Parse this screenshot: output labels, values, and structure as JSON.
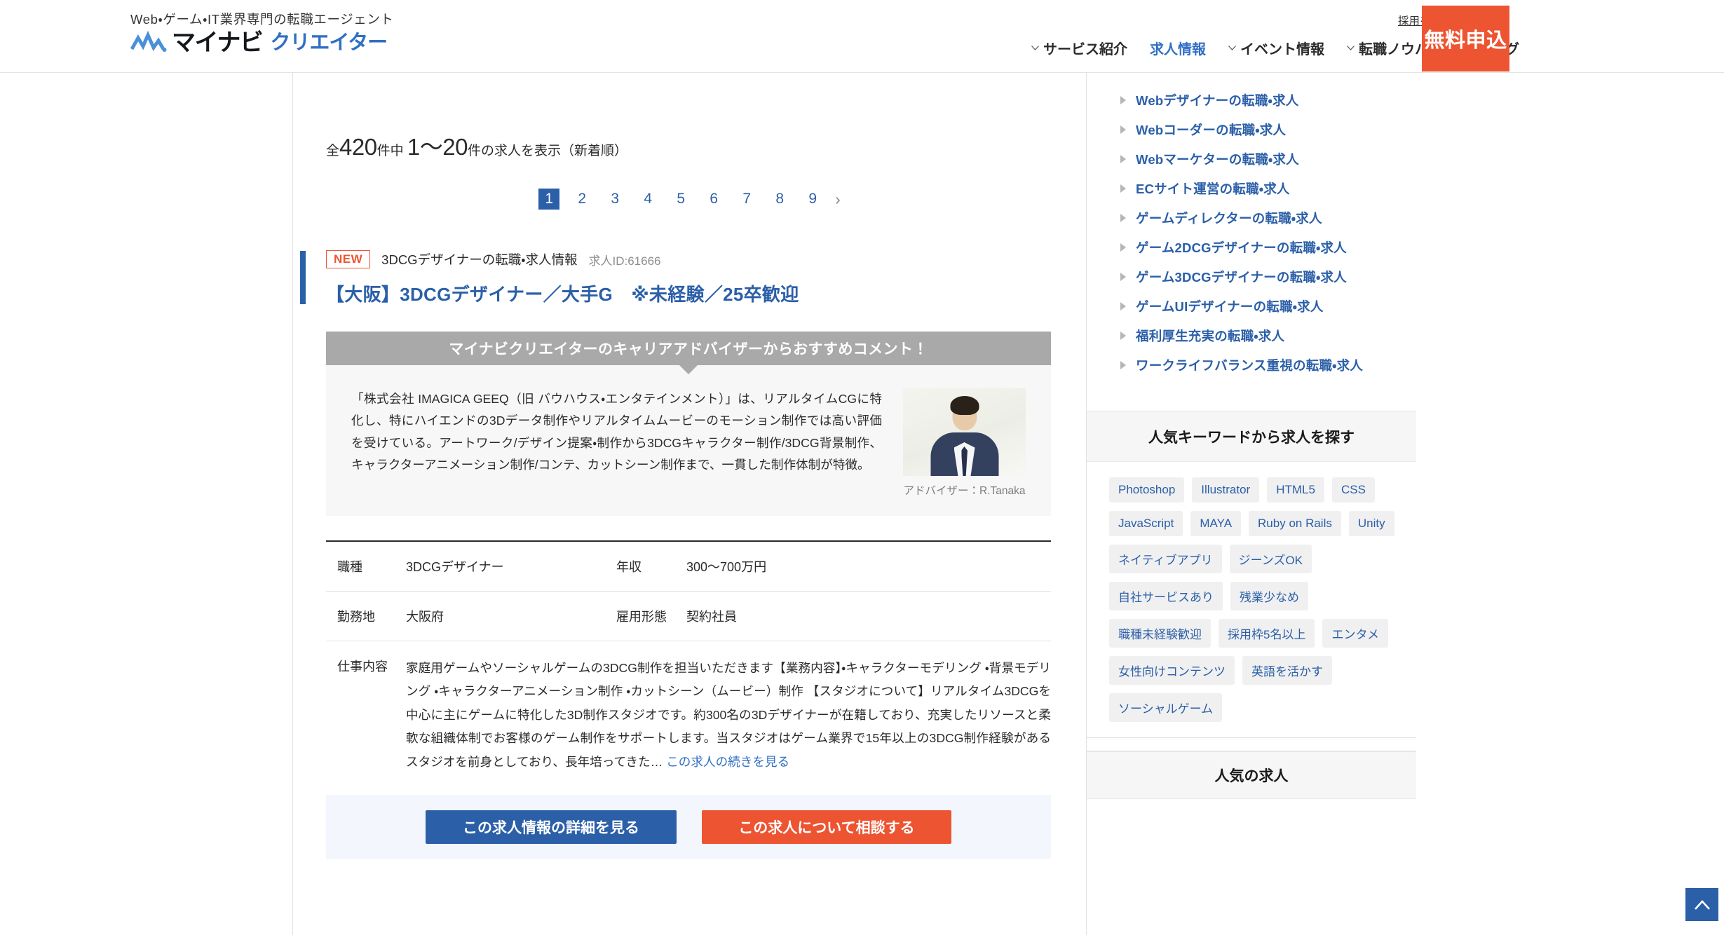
{
  "ghost": {
    "label": "この求人情報の詳細を見る"
  },
  "header": {
    "tagline": "Web・ゲーム・IT業界専門の転職エージェント",
    "logo": {
      "mark": "mynavi-wave-icon",
      "primary": "マイナビ",
      "secondary": "クリエイター"
    },
    "corporate_link": "採用を検討中の企業様",
    "nav": [
      {
        "label": "サービス紹介",
        "has_caret": true,
        "active": false
      },
      {
        "label": "求人情報",
        "has_caret": false,
        "active": true
      },
      {
        "label": "イベント情報",
        "has_caret": true,
        "active": false
      },
      {
        "label": "転職ノウハウ",
        "has_caret": true,
        "active": false
      },
      {
        "label": "ブログ",
        "has_caret": true,
        "active": false
      }
    ],
    "apply_button": "無料申込"
  },
  "results": {
    "prefix": "全",
    "total": "420",
    "mid": "件中",
    "range": "1〜20",
    "suffix": "件の求人を表示（新着順）"
  },
  "pagination": {
    "pages": [
      "1",
      "2",
      "3",
      "4",
      "5",
      "6",
      "7",
      "8",
      "9"
    ],
    "current": "1",
    "next_icon": "chevron-right-icon"
  },
  "job": {
    "badge": "NEW",
    "category": "3DCGデザイナーの転職・求人情報",
    "job_id": "求人ID:61666",
    "title": "【大阪】3DCGデザイナー／大手G　※未経験／25卒歓迎",
    "advisor": {
      "heading": "マイナビクリエイターのキャリアアドバイザーからおすすめコメント！",
      "comment": "「株式会社 IMAGICA GEEQ（旧 バウハウス・エンタテインメント）」は、リアルタイムCGに特化し、特にハイエンドの3Dデータ制作やリアルタイムムービーのモーション制作では高い評価を受けている。アートワーク/デザイン提案・制作から3DCGキャラクター制作/3DCG背景制作、キャラクターアニメーション制作/コンテ、カットシーン制作まで、一貫した制作体制が特徴。",
      "caption": "アドバイザー：R.Tanaka"
    },
    "spec": {
      "row1": {
        "label": "職種",
        "value": "3DCGデザイナー",
        "label2": "年収",
        "value2": "300〜700万円"
      },
      "row2": {
        "label": "勤務地",
        "value": "大阪府",
        "label2": "雇用形態",
        "value2": "契約社員"
      },
      "row3": {
        "label": "仕事内容",
        "value": "家庭用ゲームやソーシャルゲームの3DCG制作を担当いただきます【業務内容】・キャラクターモデリング ・背景モデリング ・キャラクターアニメーション制作 ・カットシーン（ムービー）制作 【スタジオについて】リアルタイム3DCGを中心に主にゲームに特化した3D制作スタジオです。約300名の3Dデザイナーが在籍しており、充実したリソースと柔軟な組織体制でお客様のゲーム制作をサポートします。当スタジオはゲーム業界で15年以上の3DCG制作経験があるスタジオを前身としており、長年培ってきた…",
        "more_link": "この求人の続きを見る"
      }
    },
    "cta_primary": "この求人情報の詳細を見る",
    "cta_secondary": "この求人について相談する"
  },
  "sidebar": {
    "links": [
      "Webデザイナーの転職・求人",
      "Webコーダーの転職・求人",
      "Webマーケターの転職・求人",
      "ECサイト運営の転職・求人",
      "ゲームディレクターの転職・求人",
      "ゲーム2DCGデザイナーの転職・求人",
      "ゲーム3DCGデザイナーの転職・求人",
      "ゲームUIデザイナーの転職・求人",
      "福利厚生充実の転職・求人",
      "ワークライフバランス重視の転職・求人"
    ],
    "keyword_panel": {
      "title": "人気キーワードから求人を探す",
      "tags": [
        "Photoshop",
        "Illustrator",
        "HTML5",
        "CSS",
        "JavaScript",
        "MAYA",
        "Ruby on Rails",
        "Unity",
        "ネイティブアプリ",
        "ジーンズOK",
        "自社サービスあり",
        "残業少なめ",
        "職種未経験歓迎",
        "採用枠5名以上",
        "エンタメ",
        "女性向けコンテンツ",
        "英語を活かす",
        "ソーシャルゲーム"
      ]
    },
    "popular_panel": {
      "title": "人気の求人"
    }
  },
  "to_top": {
    "icon": "chevron-up-icon"
  },
  "colors": {
    "brand_blue": "#2b5fa8",
    "link_blue": "#2f6fc4",
    "accent_orange": "#ed5432",
    "advisor_gray": "#a9a9a9",
    "panel_gray": "#f6f6f6"
  }
}
